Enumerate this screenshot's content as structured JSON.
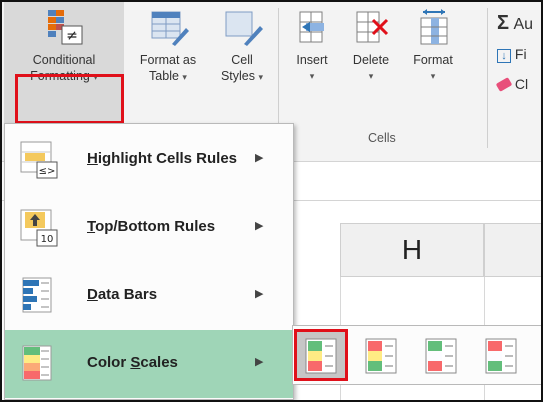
{
  "ribbon": {
    "conditional_formatting": {
      "line1": "Conditional",
      "line2": "Formatting"
    },
    "format_as_table": {
      "line1": "Format as",
      "line2": "Table"
    },
    "cell_styles": {
      "line1": "Cell",
      "line2": "Styles"
    },
    "insert": {
      "label": "Insert"
    },
    "delete": {
      "label": "Delete"
    },
    "format": {
      "label": "Format"
    },
    "cells_group_label": "Cells",
    "autosum_label": "Au",
    "fill_label": "Fi",
    "clear_label": "Cl"
  },
  "sheet": {
    "column_header": "H"
  },
  "menu": {
    "items": [
      {
        "label": "Highlight Cells Rules",
        "accel": "H",
        "rest": "ighlight Cells Rules",
        "icon": "highlight-cells-icon"
      },
      {
        "label": "Top/Bottom Rules",
        "accel": "T",
        "rest": "op/Bottom Rules",
        "icon": "top-bottom-icon",
        "icon_text": "10"
      },
      {
        "label": "Data Bars",
        "accel": "D",
        "rest": "ata Bars",
        "icon": "data-bars-icon"
      },
      {
        "label": "Color Scales",
        "pre": "Color ",
        "accel": "S",
        "rest": "cales",
        "icon": "color-scales-icon"
      }
    ],
    "highlighted_color": "#9fd5b7"
  },
  "submenu": {
    "swatches": [
      {
        "name": "green-yellow-red-color-scale",
        "colors": [
          "#63be7b",
          "#ffeb84",
          "#f8696b"
        ]
      },
      {
        "name": "red-yellow-green-color-scale",
        "colors": [
          "#f8696b",
          "#ffeb84",
          "#63be7b"
        ]
      },
      {
        "name": "green-white-red-color-scale",
        "colors": [
          "#63be7b",
          "#fcfcff",
          "#f8696b"
        ]
      },
      {
        "name": "red-white-green-color-scale",
        "colors": [
          "#f8696b",
          "#fcfcff",
          "#63be7b"
        ]
      }
    ],
    "selected_index": 0
  },
  "accent_color": "#e0101a"
}
